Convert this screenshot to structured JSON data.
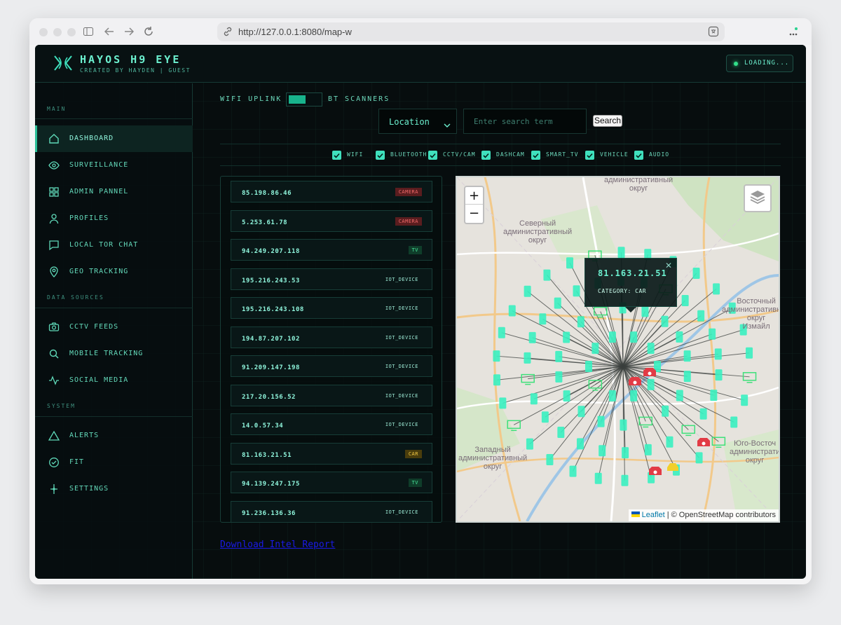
{
  "browser": {
    "url": "http://127.0.0.1:8080/map-w"
  },
  "header": {
    "title": "HAYOS H9 EYE",
    "subtitle": "CREATED BY HAYDEN | GUEST",
    "status": "LOADING..."
  },
  "sidebar": {
    "sections": {
      "main": "MAIN",
      "data_sources": "DATA SOURCES",
      "system": "SYSTEM"
    },
    "items": [
      {
        "label": "DASHBOARD",
        "icon": "home-icon"
      },
      {
        "label": "SURVEILLANCE",
        "icon": "eye-icon"
      },
      {
        "label": "ADMIN PANNEL",
        "icon": "grid-icon"
      },
      {
        "label": "PROFILES",
        "icon": "user-icon"
      },
      {
        "label": "LOCAL TOR CHAT",
        "icon": "chat-icon"
      },
      {
        "label": "GEO TRACKING",
        "icon": "map-pin-icon"
      },
      {
        "label": "CCTV FEEDS",
        "icon": "camera-icon"
      },
      {
        "label": "MOBILE TRACKING",
        "icon": "search-icon"
      },
      {
        "label": "SOCIAL MEDIA",
        "icon": "activity-icon"
      },
      {
        "label": "ALERTS",
        "icon": "warning-icon"
      },
      {
        "label": "FIT",
        "icon": "check-circle-icon"
      },
      {
        "label": "SETTINGS",
        "icon": "sparkle-icon"
      }
    ]
  },
  "controls": {
    "wifi_label": "WIFI UPLINK",
    "bt_label": "BT SCANNERS",
    "select_value": "Location",
    "search_placeholder": "Enter search term",
    "search_button": "Search"
  },
  "filters": [
    "WIFI",
    "BLUETOOTH",
    "CCTV/CAM",
    "DASHCAM",
    "SMART_TV",
    "VEHICLE",
    "AUDIO"
  ],
  "devices": [
    {
      "ip": "85.198.86.46",
      "type": "CAMERA"
    },
    {
      "ip": "5.253.61.78",
      "type": "CAMERA"
    },
    {
      "ip": "94.249.207.118",
      "type": "TV"
    },
    {
      "ip": "195.216.243.53",
      "type": "IOT_DEVICE"
    },
    {
      "ip": "195.216.243.108",
      "type": "IOT_DEVICE"
    },
    {
      "ip": "194.87.207.102",
      "type": "IOT_DEVICE"
    },
    {
      "ip": "91.209.147.198",
      "type": "IOT_DEVICE"
    },
    {
      "ip": "217.20.156.52",
      "type": "IOT_DEVICE"
    },
    {
      "ip": "14.0.57.34",
      "type": "IOT_DEVICE"
    },
    {
      "ip": "81.163.21.51",
      "type": "CAR"
    },
    {
      "ip": "94.139.247.175",
      "type": "TV"
    },
    {
      "ip": "91.236.136.36",
      "type": "IOT_DEVICE"
    }
  ],
  "download_link": "Download Intel Report",
  "map": {
    "popup_ip": "81.163.21.51",
    "popup_category": "CATEGORY: CAR",
    "attribution_leaflet": "Leaflet",
    "attribution_osm": "| © OpenStreetMap contributors",
    "labels": {
      "north_a": "административный",
      "north_b": "округ",
      "cnw_a": "Северный",
      "cnw_b": "административный",
      "cnw_c": "округ",
      "ne_a": "Восточный",
      "ne_b": "административный",
      "ne_c": "округ",
      "ne_d": "Измайл",
      "west_a": "Западный",
      "west_b": "административный",
      "west_c": "округ",
      "se_a": "Юго-Восточ",
      "se_b": "администрати",
      "se_c": "округ"
    },
    "colors": {
      "iot": "#38f0c0",
      "camera": "#e23b45",
      "car": "#f2cf2a",
      "tv": "#3ee07a"
    }
  }
}
